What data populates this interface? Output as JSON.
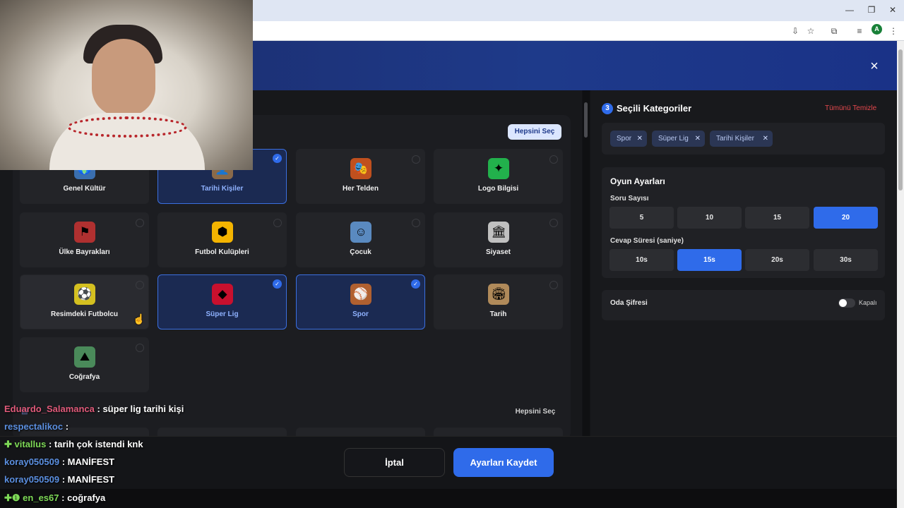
{
  "browser": {
    "window_controls": {
      "minimize": "—",
      "restore": "❐",
      "close": "✕"
    },
    "profile_initial": "A"
  },
  "modal": {
    "close_icon": "×",
    "select_all_label": "Hepsini Seç",
    "select_all_label_2": "Hepsini Seç",
    "categories": [
      {
        "label": "Genel Kültür",
        "icon": "globe-icon",
        "selected": false
      },
      {
        "label": "Tarihi Kişiler",
        "icon": "historic-person-icon",
        "selected": true
      },
      {
        "label": "Her Telden",
        "icon": "mixed-icon",
        "selected": false
      },
      {
        "label": "Logo Bilgisi",
        "icon": "logo-icon",
        "selected": false
      },
      {
        "label": "Ülke Bayrakları",
        "icon": "flag-icon",
        "selected": false
      },
      {
        "label": "Futbol Kulüpleri",
        "icon": "wolf-crest-icon",
        "selected": false
      },
      {
        "label": "Çocuk",
        "icon": "child-icon",
        "selected": false
      },
      {
        "label": "Siyaset",
        "icon": "parliament-icon",
        "selected": false
      },
      {
        "label": "Resimdeki Futbolcu",
        "icon": "footballer-icon",
        "selected": false
      },
      {
        "label": "Süper Lig",
        "icon": "league-logo-icon",
        "selected": true
      },
      {
        "label": "Spor",
        "icon": "sports-balls-icon",
        "selected": true
      },
      {
        "label": "Tarih",
        "icon": "colosseum-icon",
        "selected": false
      },
      {
        "label": "Coğrafya",
        "icon": "mountain-icon",
        "selected": false
      }
    ],
    "selected_panel": {
      "count": "3",
      "title": "Seçili Kategoriler",
      "clear_all": "Tümünü Temizle",
      "chips": [
        "Spor",
        "Süper Lig",
        "Tarihi Kişiler"
      ],
      "chip_remove": "✕"
    },
    "game_settings": {
      "title": "Oyun Ayarları",
      "question_count_label": "Soru Sayısı",
      "question_counts": [
        "5",
        "10",
        "15",
        "20"
      ],
      "question_count_selected": "20",
      "answer_time_label": "Cevap Süresi (saniye)",
      "answer_times": [
        "10s",
        "15s",
        "20s",
        "30s"
      ],
      "answer_time_selected": "15s"
    },
    "room_password": {
      "label": "Oda Şifresi",
      "state": "Kapalı"
    },
    "cancel_label": "İptal",
    "save_label": "Ayarları Kaydet"
  },
  "chat": [
    {
      "user": "Eduardo_Salamanca",
      "text": ": süper lig tarihi kişi",
      "color": "#e05a7a"
    },
    {
      "user": "respectalikoc",
      "text": ":",
      "color": "#5b8fe0"
    },
    {
      "user": "vitallus",
      "text": ": tarih çok istendi knk",
      "color": "#7ed957",
      "badge": "✚"
    },
    {
      "user": "koray050509",
      "text": ": MANİFEST",
      "color": "#5b8fe0"
    },
    {
      "user": "koray050509",
      "text": ": MANİFEST",
      "color": "#5b8fe0"
    },
    {
      "user": "en_es67",
      "text": ": coğrafya",
      "color": "#7ed957",
      "badge": "✚❶"
    }
  ]
}
